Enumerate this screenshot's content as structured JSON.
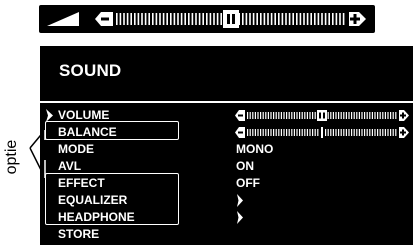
{
  "volume_bar": {
    "icon": "volume-wedge-icon",
    "level": 0.5
  },
  "menu": {
    "title": "SOUND",
    "selected_index": 0,
    "items": [
      {
        "label": "VOLUME",
        "value": "",
        "control": "slider",
        "level": 0.5
      },
      {
        "label": "BALANCE",
        "value": "",
        "control": "slider",
        "level": 0.5
      },
      {
        "label": "MODE",
        "value": "MONO",
        "control": "text"
      },
      {
        "label": "AVL",
        "value": "ON",
        "control": "text"
      },
      {
        "label": "EFFECT",
        "value": "OFF",
        "control": "text"
      },
      {
        "label": "EQUALIZER",
        "value": "",
        "control": "submenu"
      },
      {
        "label": "HEADPHONE",
        "value": "",
        "control": "submenu"
      },
      {
        "label": "STORE",
        "value": "",
        "control": "none"
      }
    ]
  },
  "annotation": {
    "label": "optie"
  },
  "colors": {
    "panel": "#000000",
    "text": "#ffffff",
    "background": "#ffffff"
  }
}
